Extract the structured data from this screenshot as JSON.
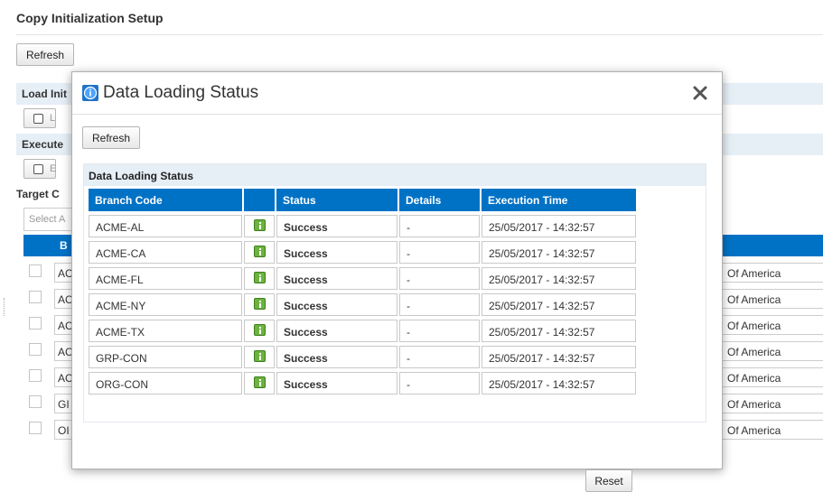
{
  "page": {
    "title": "Copy Initialization Setup",
    "refresh_label": "Refresh"
  },
  "background": {
    "load_section": "Load Init",
    "load_button_text": "L",
    "execute_section": "Execute",
    "execute_button_text": "E",
    "target_section": "Target C",
    "select_placeholder": "Select A",
    "table_header": "B",
    "rows": [
      {
        "code": "AC",
        "region": "Of America"
      },
      {
        "code": "AC",
        "region": "Of America"
      },
      {
        "code": "AC",
        "region": "Of America"
      },
      {
        "code": "AC",
        "region": "Of America"
      },
      {
        "code": "AC",
        "region": "Of America"
      },
      {
        "code": "GI",
        "region": "Of America"
      },
      {
        "code": "OI",
        "region": "Of America"
      }
    ]
  },
  "modal": {
    "title": "Data Loading Status",
    "icon": "info-icon",
    "close_icon": "close-icon",
    "refresh_label": "Refresh",
    "panel_title": "Data Loading Status",
    "columns": {
      "branch_code": "Branch Code",
      "icon": "",
      "status": "Status",
      "details": "Details",
      "execution_time": "Execution Time"
    },
    "rows": [
      {
        "branch_code": "ACME-AL",
        "status": "Success",
        "details": "-",
        "execution_time": "25/05/2017 - 14:32:57"
      },
      {
        "branch_code": "ACME-CA",
        "status": "Success",
        "details": "-",
        "execution_time": "25/05/2017 - 14:32:57"
      },
      {
        "branch_code": "ACME-FL",
        "status": "Success",
        "details": "-",
        "execution_time": "25/05/2017 - 14:32:57"
      },
      {
        "branch_code": "ACME-NY",
        "status": "Success",
        "details": "-",
        "execution_time": "25/05/2017 - 14:32:57"
      },
      {
        "branch_code": "ACME-TX",
        "status": "Success",
        "details": "-",
        "execution_time": "25/05/2017 - 14:32:57"
      },
      {
        "branch_code": "GRP-CON",
        "status": "Success",
        "details": "-",
        "execution_time": "25/05/2017 - 14:32:57"
      },
      {
        "branch_code": "ORG-CON",
        "status": "Success",
        "details": "-",
        "execution_time": "25/05/2017 - 14:32:57"
      }
    ],
    "reset_label": "Reset"
  },
  "colors": {
    "header_blue": "#0072c6",
    "section_bar": "#e6eef6",
    "details_icon_green": "#6cb33f"
  }
}
